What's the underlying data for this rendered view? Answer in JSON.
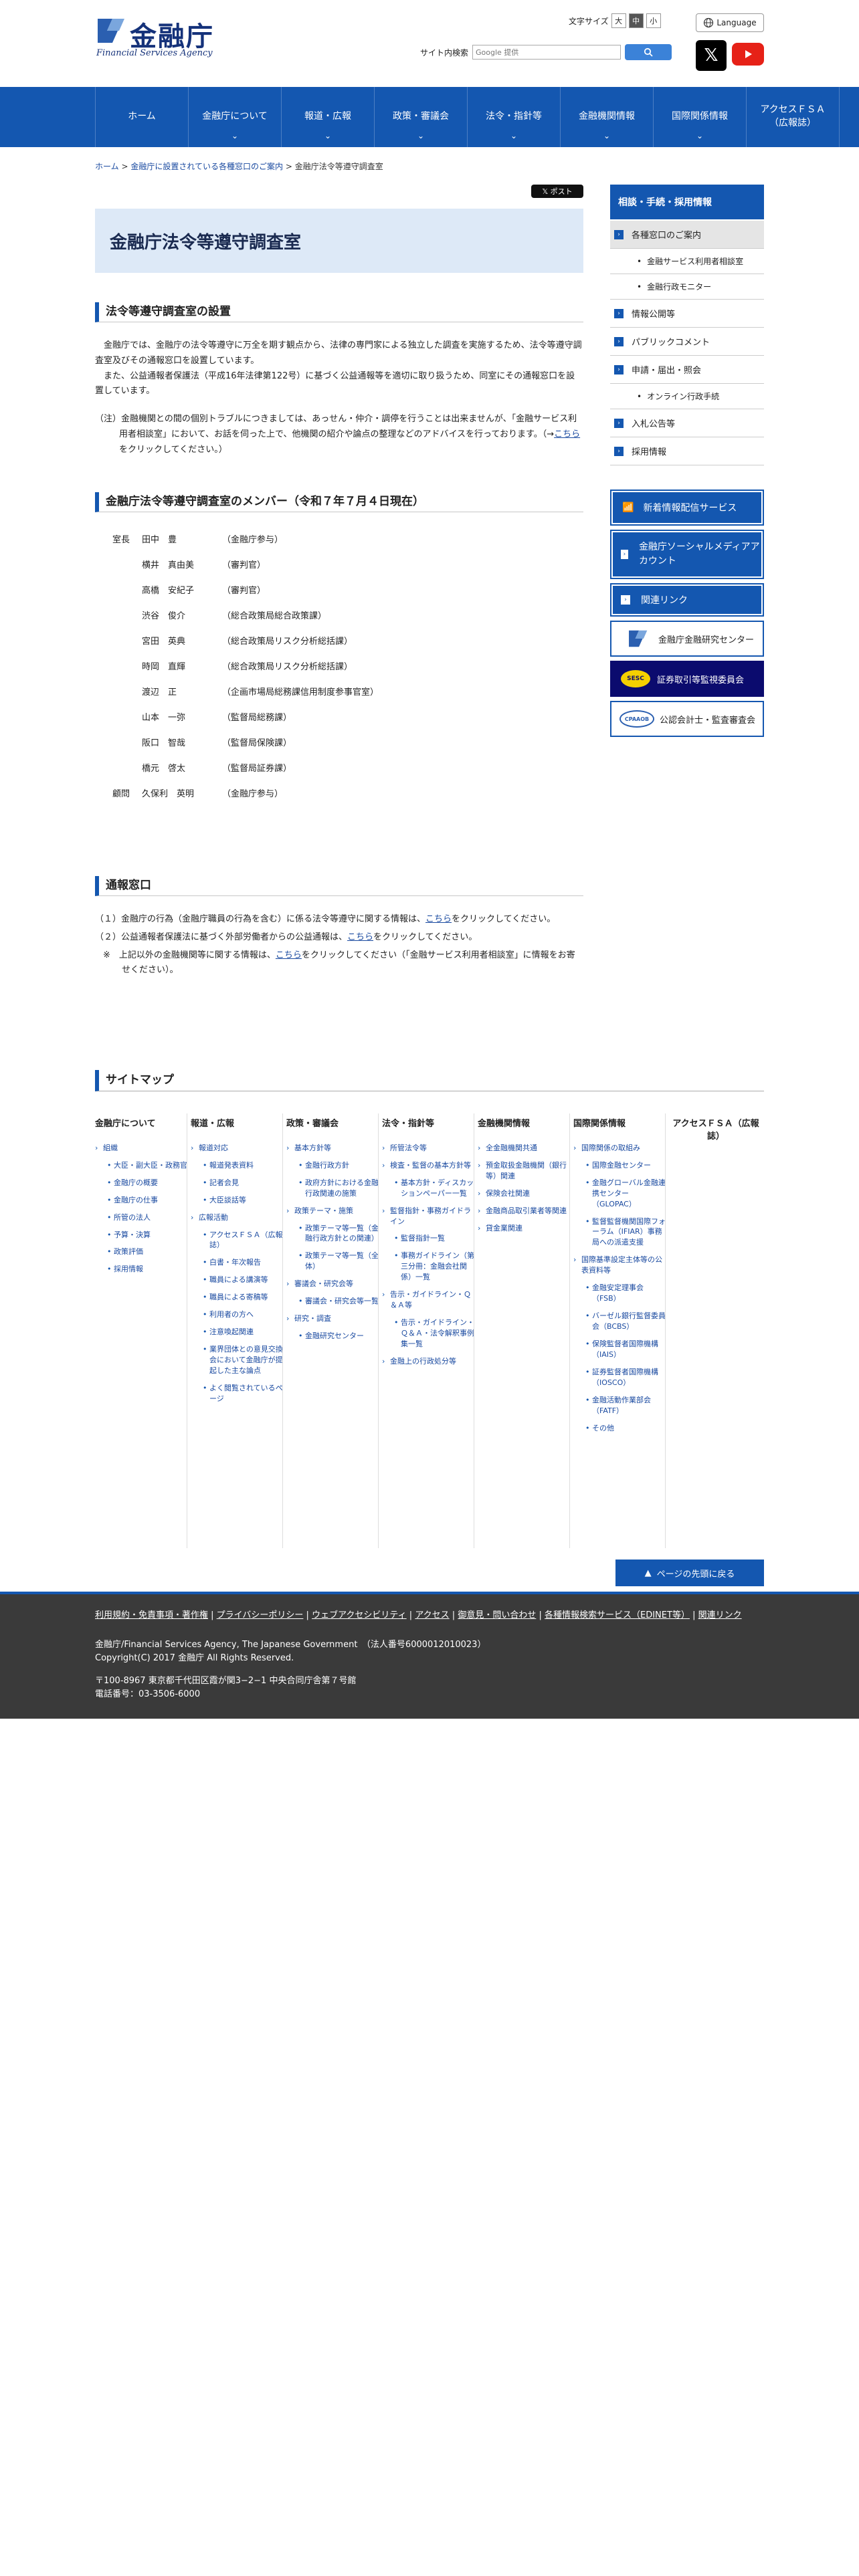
{
  "header": {
    "logo_jp": "金融庁",
    "logo_en": "Financial Services Agency",
    "fontsize_label": "文字サイズ",
    "fontsize_options": [
      "大",
      "中",
      "小"
    ],
    "language_label": "Language",
    "search_label": "サイト内検索",
    "search_placeholder": "Google 提供"
  },
  "gnav": [
    {
      "label": "ホーム",
      "label2": ""
    },
    {
      "label": "金融庁について",
      "label2": ""
    },
    {
      "label": "報道・広報",
      "label2": ""
    },
    {
      "label": "政策・審議会",
      "label2": ""
    },
    {
      "label": "法令・指針等",
      "label2": ""
    },
    {
      "label": "金融機関情報",
      "label2": ""
    },
    {
      "label": "国際関係情報",
      "label2": ""
    },
    {
      "label": "アクセスＦＳＡ",
      "label2": "（広報誌）"
    }
  ],
  "breadcrumb": {
    "home": "ホーム",
    "parent": "金融庁に設置されている各種窓口のご案内",
    "current": "金融庁法令等遵守調査室",
    "sep": ">"
  },
  "main": {
    "tweet": "ポスト",
    "title": "金融庁法令等遵守調査室",
    "sec1_heading": "法令等遵守調査室の設置",
    "sec1_p1": "　金融庁では、金融庁の法令等遵守に万全を期す観点から、法律の専門家による独立した調査を実施するため、法令等遵守調査室及びその通報窓口を設置しています。",
    "sec1_p2": "　また、公益通報者保護法（平成16年法律第122号）に基づく公益通報等を適切に取り扱うため、同室にその通報窓口を設置しています。",
    "sec1_note_a": "（注）金融機関との間の個別トラブルにつきましては、あっせん・仲介・調停を行うことは出来ませんが、「金融サービス利用者相談室」において、お話を伺った上で、他機関の紹介や論点の整理などのアドバイスを行っております。（→",
    "sec1_note_link": "こちら",
    "sec1_note_b": "をクリックしてください。）",
    "sec2_heading": "金融庁法令等遵守調査室のメンバー（令和７年７月４日現在）",
    "members": [
      {
        "role": "室長",
        "name": "田中　豊",
        "post": "（金融庁参与）"
      },
      {
        "role": "",
        "name": "横井　真由美",
        "post": "（審判官）"
      },
      {
        "role": "",
        "name": "高橋　安紀子",
        "post": "（審判官）"
      },
      {
        "role": "",
        "name": "渋谷　俊介",
        "post": "（総合政策局総合政策課）"
      },
      {
        "role": "",
        "name": "宮田　英典",
        "post": "（総合政策局リスク分析総括課）"
      },
      {
        "role": "",
        "name": "時岡　直輝",
        "post": "（総合政策局リスク分析総括課）"
      },
      {
        "role": "",
        "name": "渡辺　正",
        "post": "（企画市場局総務課信用制度参事官室）"
      },
      {
        "role": "",
        "name": "山本　一弥",
        "post": "（監督局総務課）"
      },
      {
        "role": "",
        "name": "阪口　智哉",
        "post": "（監督局保険課）"
      },
      {
        "role": "",
        "name": "橋元　啓太",
        "post": "（監督局証券課）"
      },
      {
        "role": "顧問",
        "name": "久保利　英明",
        "post": "（金融庁参与）"
      }
    ],
    "sec3_heading": "通報窓口",
    "sec3_p1_a": "（１）金融庁の行為（金融庁職員の行為を含む）に係る法令等遵守に関する情報は、",
    "sec3_p1_link": "こちら",
    "sec3_p1_b": "をクリックしてください。",
    "sec3_p2_a": "（２）公益通報者保護法に基づく外部労働者からの公益通報は、",
    "sec3_p2_link": "こちら",
    "sec3_p2_b": "をクリックしてください。",
    "sec3_note_a": "※　上記以外の金融機関等に関する情報は、",
    "sec3_note_link": "こちら",
    "sec3_note_b": "をクリックしてください（「金融サービス利用者相談室」に情報をお寄せください）。"
  },
  "side": {
    "head": "相談・手続・採用情報",
    "items": [
      {
        "label": "各種窓口のご案内",
        "type": "main",
        "hl": true
      },
      {
        "label": "金融サービス利用者相談室",
        "type": "sub"
      },
      {
        "label": "金融行政モニター",
        "type": "sub"
      },
      {
        "label": "情報公開等",
        "type": "main"
      },
      {
        "label": "パブリックコメント",
        "type": "main"
      },
      {
        "label": "申請・届出・照会",
        "type": "main"
      },
      {
        "label": "オンライン行政手続",
        "type": "sub"
      },
      {
        "label": "入札公告等",
        "type": "main"
      },
      {
        "label": "採用情報",
        "type": "main"
      }
    ],
    "btn_mail": "新着情報配信サービス",
    "btn_social": "金融庁ソーシャルメディアアカウント",
    "btn_links": "関連リンク",
    "banner_research": "金融庁金融研究センター",
    "banner_sesc": "証券取引等監視委員会",
    "banner_sesc_logo": "SESC",
    "banner_cpaaob": "公認会計士・監査審査会",
    "banner_cpaaob_logo": "CPAAOB"
  },
  "sitemap": {
    "title": "サイトマップ",
    "cols": [
      {
        "cap": "金融庁について",
        "items": [
          [
            "l1",
            "組織"
          ],
          [
            "l2",
            "大臣・副大臣・政務官"
          ],
          [
            "l2",
            "金融庁の概要"
          ],
          [
            "l2",
            "金融庁の仕事"
          ],
          [
            "l2",
            "所管の法人"
          ],
          [
            "l2",
            "予算・決算"
          ],
          [
            "l2",
            "政策評価"
          ],
          [
            "l2",
            "採用情報"
          ]
        ]
      },
      {
        "cap": "報道・広報",
        "items": [
          [
            "l1",
            "報道対応"
          ],
          [
            "l2",
            "報道発表資料"
          ],
          [
            "l2",
            "記者会見"
          ],
          [
            "l2",
            "大臣談話等"
          ],
          [
            "l1",
            "広報活動"
          ],
          [
            "l2",
            "アクセスＦＳＡ（広報誌）"
          ],
          [
            "l2",
            "白書・年次報告"
          ],
          [
            "l2",
            "職員による講演等"
          ],
          [
            "l2",
            "職員による寄稿等"
          ],
          [
            "l2",
            "利用者の方へ"
          ],
          [
            "l2",
            "注意喚起関連"
          ],
          [
            "l2",
            "業界団体との意見交換会において金融庁が提起した主な論点"
          ],
          [
            "l2",
            "よく閲覧されているページ"
          ]
        ]
      },
      {
        "cap": "政策・審議会",
        "items": [
          [
            "l1",
            "基本方針等"
          ],
          [
            "l2",
            "金融行政方針"
          ],
          [
            "l2",
            "政府方針における金融行政関連の施策"
          ],
          [
            "l1",
            "政策テーマ・施策"
          ],
          [
            "l2",
            "政策テーマ等一覧（金融行政方針との関連）"
          ],
          [
            "l2",
            "政策テーマ等一覧（全体）"
          ],
          [
            "l1",
            "審議会・研究会等"
          ],
          [
            "l2",
            "審議会・研究会等一覧"
          ],
          [
            "l1",
            "研究・調査"
          ],
          [
            "l2",
            "金融研究センター"
          ]
        ]
      },
      {
        "cap": "法令・指針等",
        "items": [
          [
            "l1",
            "所管法令等"
          ],
          [
            "l1",
            "検査・監督の基本方針等"
          ],
          [
            "l2",
            "基本方針・ディスカッションペーパー一覧"
          ],
          [
            "l1",
            "監督指針・事務ガイドライン"
          ],
          [
            "l2",
            "監督指針一覧"
          ],
          [
            "l2",
            "事務ガイドライン（第三分冊：金融会社関係）一覧"
          ],
          [
            "l1",
            "告示・ガイドライン・Ｑ＆Ａ等"
          ],
          [
            "l2",
            "告示・ガイドライン・Ｑ＆Ａ・法令解釈事例集一覧"
          ],
          [
            "l1",
            "金融上の行政処分等"
          ]
        ]
      },
      {
        "cap": "金融機関情報",
        "items": [
          [
            "l1",
            "全金融機関共通"
          ],
          [
            "l1",
            "預金取扱金融機関（銀行等）関連"
          ],
          [
            "l1",
            "保険会社関連"
          ],
          [
            "l1",
            "金融商品取引業者等関連"
          ],
          [
            "l1",
            "貸金業関連"
          ]
        ]
      },
      {
        "cap": "国際関係情報",
        "items": [
          [
            "l1",
            "国際関係の取組み"
          ],
          [
            "l2",
            "国際金融センター"
          ],
          [
            "l2",
            "金融グローバル金融連携センター（GLOPAC）"
          ],
          [
            "l2",
            "監督監督機関国際フォーラム（IFIAR）事務局への派遣支援"
          ],
          [
            "l1",
            "国際基準設定主体等の公表資料等"
          ],
          [
            "l2",
            "金融安定理事会（FSB）"
          ],
          [
            "l2",
            "バーゼル銀行監督委員会（BCBS）"
          ],
          [
            "l2",
            "保険監督者国際機構（IAIS）"
          ],
          [
            "l2",
            "証券監督者国際機構（IOSCO）"
          ],
          [
            "l2",
            "金融活動作業部会（FATF）"
          ],
          [
            "l2",
            "その他"
          ]
        ]
      },
      {
        "cap": "アクセスＦＳＡ（広報誌）",
        "items": []
      }
    ]
  },
  "pagetop": "ページの先頭に戻る",
  "footer": {
    "links": [
      "利用規約・免責事項・著作権",
      "プライバシーポリシー",
      "ウェブアクセシビリティ",
      "アクセス",
      "御意見・問い合わせ",
      "各種情報検索サービス（EDINET等）",
      "関連リンク"
    ],
    "line1": "金融庁/Financial Services Agency, The Japanese Government　（法人番号6000012010023）",
    "line2": "Copyright(C) 2017 金融庁 All Rights Reserved.",
    "line3": "〒100-8967 東京都千代田区霞が関3−2−1 中央合同庁舎第７号館",
    "line4": "電話番号：03-3506-6000"
  }
}
